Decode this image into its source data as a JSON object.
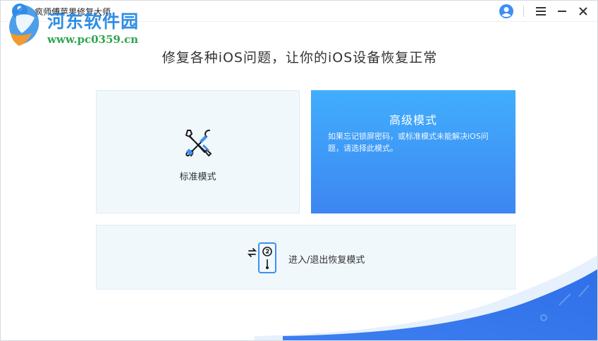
{
  "titlebar": {
    "app_title": "疯师傅苹果修复大师",
    "icons": [
      "app-logo-icon",
      "user-icon",
      "menu-icon",
      "minimize-icon",
      "close-icon"
    ]
  },
  "watermark": {
    "site_name": "河东软件园",
    "site_url": "www.pc0359.cn"
  },
  "main": {
    "heading": "修复各种iOS问题，让你的iOS设备恢复正常",
    "standard_mode": {
      "label": "标准模式",
      "icon": "wrench-screwdriver-icon"
    },
    "advanced_mode": {
      "title": "高级模式",
      "description": "如果忘记锁屏密码，或标准模式未能解决iOS问题，请选择此模式。"
    },
    "recovery_mode": {
      "label": "进入/退出恢复模式",
      "icon": "phone-exchange-icon"
    }
  },
  "colors": {
    "accent": "#3d8ef5",
    "card_bg": "#f1f8fc",
    "watermark_blue": "#2f8de6",
    "watermark_green": "#2ea44f"
  }
}
